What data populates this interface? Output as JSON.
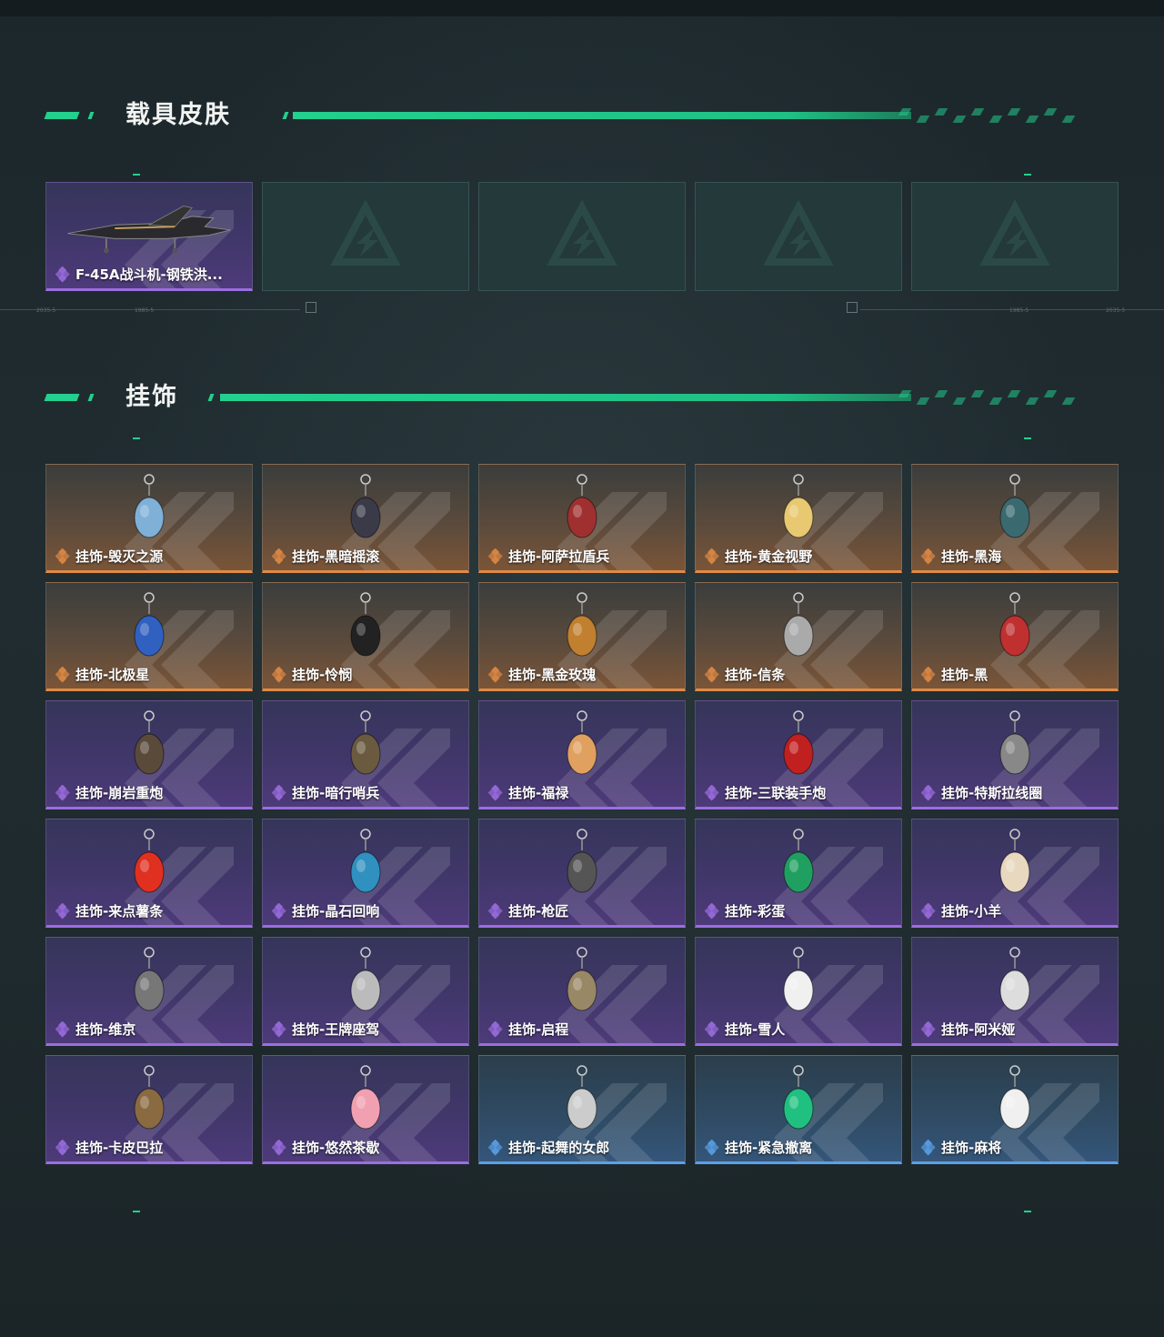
{
  "colors": {
    "accent": "#23d08e",
    "orange": "#e08a45",
    "purple": "#9b6ee0",
    "blue": "#5aa0e8"
  },
  "sections": {
    "vehicle": {
      "title": "载具皮肤"
    },
    "charms": {
      "title": "挂饰"
    }
  },
  "vehicle_items": [
    {
      "label": "F-45A战斗机-钢铁洪...",
      "rarity": "purple",
      "icon": "fighter-jet-icon"
    },
    {
      "label": "",
      "rarity": "empty"
    },
    {
      "label": "",
      "rarity": "empty"
    },
    {
      "label": "",
      "rarity": "empty"
    },
    {
      "label": "",
      "rarity": "empty"
    }
  ],
  "timeline": {
    "left_a": "2035-5",
    "left_b": "1985-5",
    "right_a": "1985-5",
    "right_b": "2035-5"
  },
  "charm_items": [
    {
      "label": "挂饰-毁灭之源",
      "rarity": "orange",
      "icon": "dragon-charm-icon"
    },
    {
      "label": "挂饰-黑暗摇滚",
      "rarity": "orange",
      "icon": "rock-charm-icon"
    },
    {
      "label": "挂饰-阿萨拉盾兵",
      "rarity": "orange",
      "icon": "shield-soldier-charm-icon"
    },
    {
      "label": "挂饰-黄金视野",
      "rarity": "orange",
      "icon": "golden-vision-charm-icon"
    },
    {
      "label": "挂饰-黑海",
      "rarity": "orange",
      "icon": "anchor-charm-icon"
    },
    {
      "label": "挂饰-北极星",
      "rarity": "orange",
      "icon": "star-charm-icon"
    },
    {
      "label": "挂饰-怜悯",
      "rarity": "orange",
      "icon": "dagger-charm-icon"
    },
    {
      "label": "挂饰-黑金玫瑰",
      "rarity": "orange",
      "icon": "rose-charm-icon"
    },
    {
      "label": "挂饰-信条",
      "rarity": "orange",
      "icon": "creed-charm-icon"
    },
    {
      "label": "挂饰-黑",
      "rarity": "orange",
      "icon": "tag-charm-icon"
    },
    {
      "label": "挂饰-崩岩重炮",
      "rarity": "purple",
      "icon": "bear-charm-icon"
    },
    {
      "label": "挂饰-暗行哨兵",
      "rarity": "purple",
      "icon": "sentinel-charm-icon"
    },
    {
      "label": "挂饰-福禄",
      "rarity": "purple",
      "icon": "gourd-charm-icon"
    },
    {
      "label": "挂饰-三联装手炮",
      "rarity": "purple",
      "icon": "cannon-charm-icon"
    },
    {
      "label": "挂饰-特斯拉线圈",
      "rarity": "purple",
      "icon": "coil-charm-icon"
    },
    {
      "label": "挂饰-来点薯条",
      "rarity": "purple",
      "icon": "fries-charm-icon"
    },
    {
      "label": "挂饰-晶石回响",
      "rarity": "purple",
      "icon": "crystal-charm-icon"
    },
    {
      "label": "挂饰-枪匠",
      "rarity": "purple",
      "icon": "gunsmith-charm-icon"
    },
    {
      "label": "挂饰-彩蛋",
      "rarity": "purple",
      "icon": "egg-charm-icon"
    },
    {
      "label": "挂饰-小羊",
      "rarity": "purple",
      "icon": "lamb-charm-icon"
    },
    {
      "label": "挂饰-维京",
      "rarity": "purple",
      "icon": "axe-charm-icon"
    },
    {
      "label": "挂饰-王牌座驾",
      "rarity": "purple",
      "icon": "plane-charm-icon"
    },
    {
      "label": "挂饰-启程",
      "rarity": "purple",
      "icon": "compass-charm-icon"
    },
    {
      "label": "挂饰-雪人",
      "rarity": "purple",
      "icon": "snowman-charm-icon"
    },
    {
      "label": "挂饰-阿米娅",
      "rarity": "purple",
      "icon": "bunny-charm-icon"
    },
    {
      "label": "挂饰-卡皮巴拉",
      "rarity": "purple",
      "icon": "capybara-charm-icon"
    },
    {
      "label": "挂饰-悠然茶歇",
      "rarity": "purple",
      "icon": "cupcake-charm-icon"
    },
    {
      "label": "挂饰-起舞的女郎",
      "rarity": "blue",
      "icon": "dancer-charm-icon"
    },
    {
      "label": "挂饰-紧急撤离",
      "rarity": "blue",
      "icon": "exit-charm-icon"
    },
    {
      "label": "挂饰-麻将",
      "rarity": "blue",
      "icon": "mahjong-charm-icon"
    }
  ]
}
